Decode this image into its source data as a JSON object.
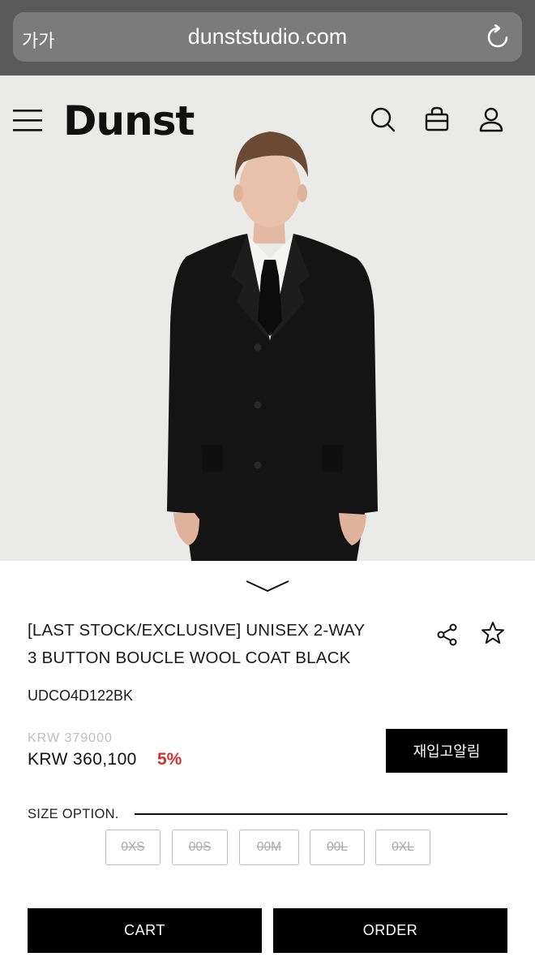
{
  "browser": {
    "text_size_label": "가가",
    "url": "dunststudio.com"
  },
  "header": {
    "logo": "Dunst"
  },
  "product": {
    "title_line1": "[LAST STOCK/EXCLUSIVE] UNISEX 2-WAY",
    "title_line2": "3 BUTTON BOUCLE WOOL COAT BLACK",
    "code": "UDCO4D122BK",
    "original_price": "KRW 379000",
    "price": "KRW 360,100",
    "discount": "5%"
  },
  "restock_button": "재입고알림",
  "size": {
    "label": "SIZE OPTION.",
    "options": [
      "0XS",
      "00S",
      "00M",
      "00L",
      "0XL"
    ]
  },
  "actions": {
    "cart": "CART",
    "order": "ORDER"
  },
  "icons": {
    "menu": "hamburger-icon",
    "search": "search-icon",
    "bag": "shopping-bag-icon",
    "account": "user-icon",
    "share": "share-icon",
    "wishlist": "star-icon",
    "scroll": "chevron-down-icon",
    "reload": "reload-icon"
  },
  "colors": {
    "discount": "#d0312d",
    "button": "#000000"
  }
}
